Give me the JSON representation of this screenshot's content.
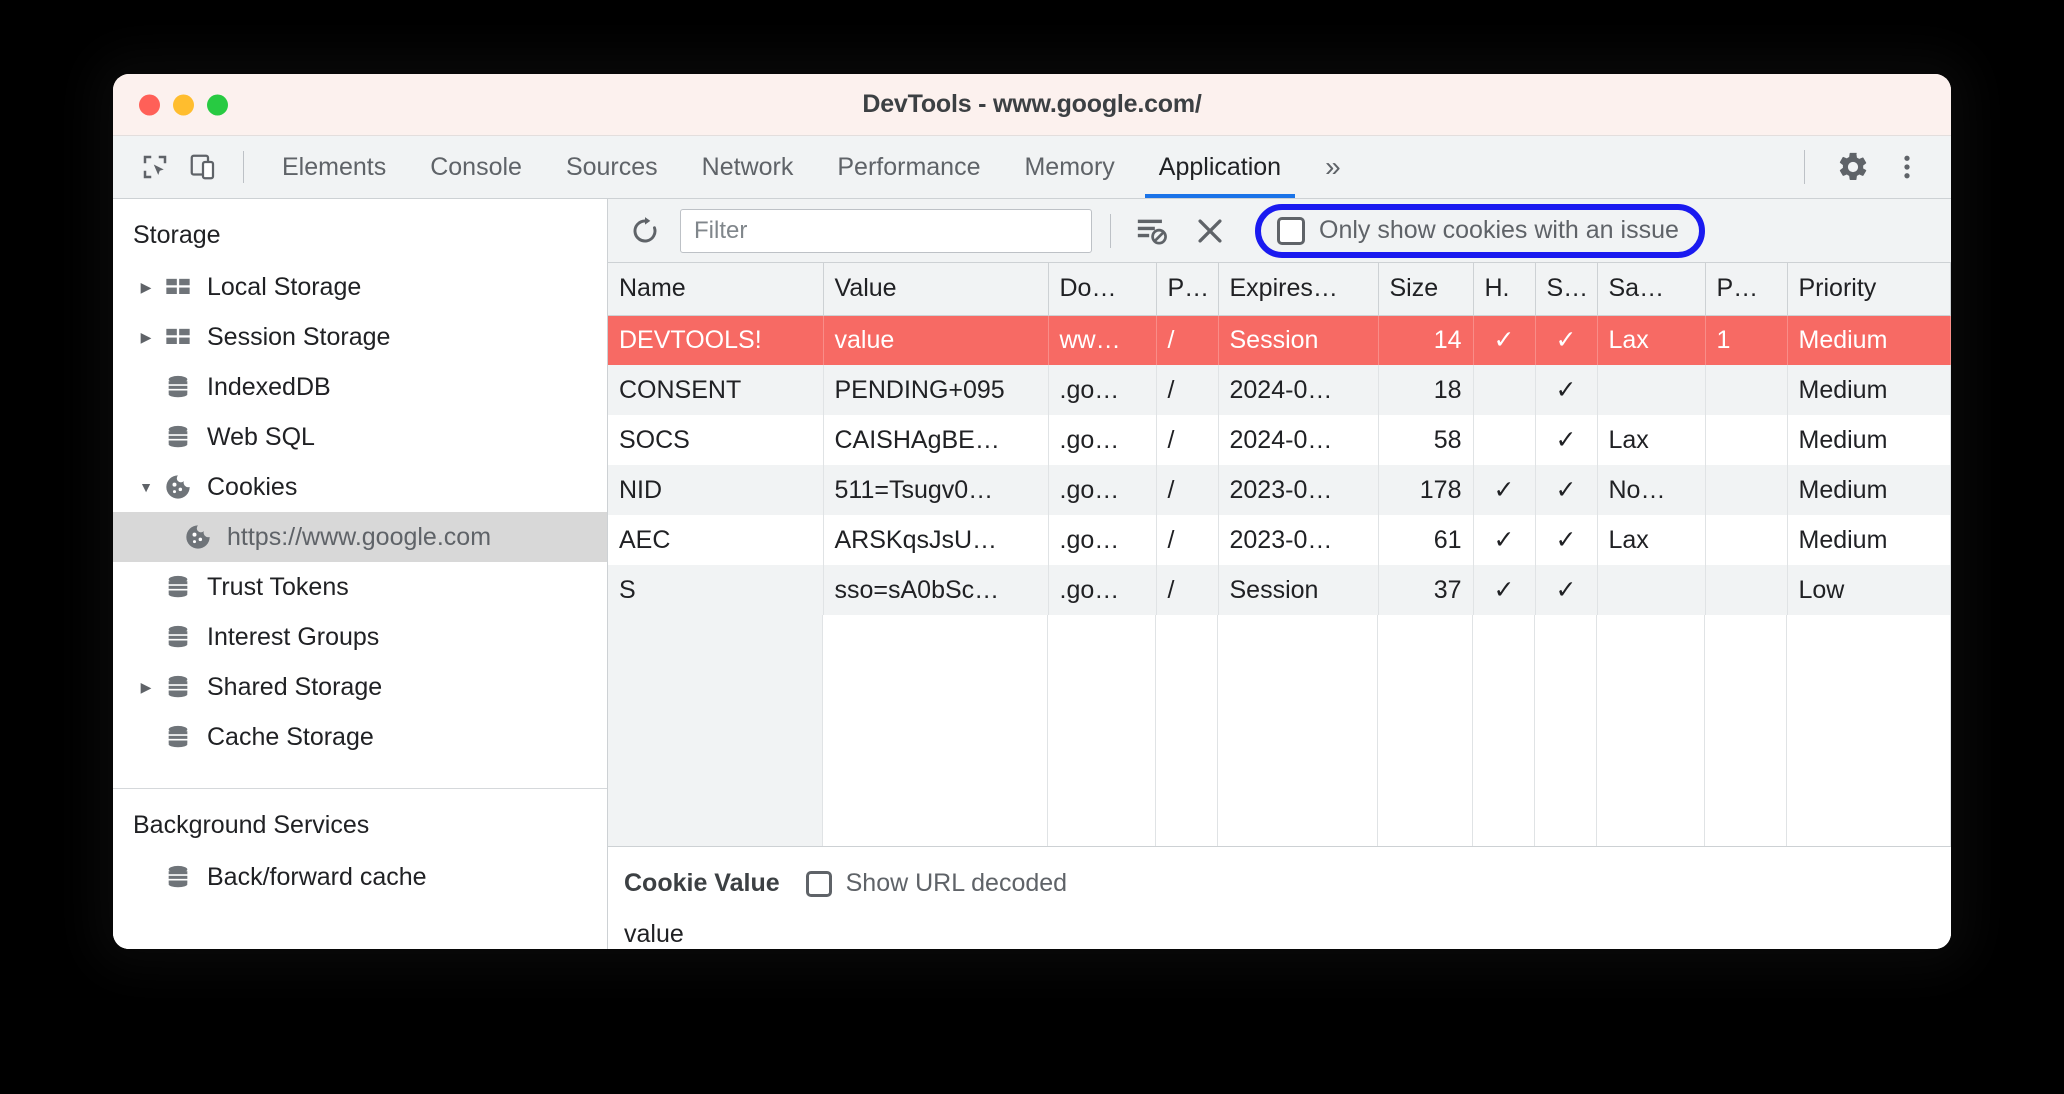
{
  "window": {
    "title": "DevTools - www.google.com/",
    "traffic_lights": [
      "close",
      "minimize",
      "zoom"
    ]
  },
  "tabbar": {
    "inspect_icon": "cursor-select-icon",
    "device_icon": "device-toolbar-icon",
    "tabs": [
      {
        "label": "Elements",
        "active": false
      },
      {
        "label": "Console",
        "active": false
      },
      {
        "label": "Sources",
        "active": false
      },
      {
        "label": "Network",
        "active": false
      },
      {
        "label": "Performance",
        "active": false
      },
      {
        "label": "Memory",
        "active": false
      },
      {
        "label": "Application",
        "active": true
      }
    ],
    "more_tabs": "»",
    "settings_icon": "gear-icon",
    "menu_icon": "kebab-menu-icon"
  },
  "sidebar": {
    "sections": [
      {
        "title": "Storage",
        "items": [
          {
            "label": "Local Storage",
            "icon": "table-icon",
            "twisty": "collapsed",
            "indent": 1,
            "selected": false
          },
          {
            "label": "Session Storage",
            "icon": "table-icon",
            "twisty": "collapsed",
            "indent": 1,
            "selected": false
          },
          {
            "label": "IndexedDB",
            "icon": "database-icon",
            "twisty": "none",
            "indent": 1,
            "selected": false
          },
          {
            "label": "Web SQL",
            "icon": "database-icon",
            "twisty": "none",
            "indent": 1,
            "selected": false
          },
          {
            "label": "Cookies",
            "icon": "cookie-icon",
            "twisty": "expanded",
            "indent": 1,
            "selected": false
          },
          {
            "label": "https://www.google.com",
            "icon": "cookie-icon",
            "twisty": "none",
            "indent": 2,
            "selected": true
          },
          {
            "label": "Trust Tokens",
            "icon": "database-icon",
            "twisty": "none",
            "indent": 1,
            "selected": false
          },
          {
            "label": "Interest Groups",
            "icon": "database-icon",
            "twisty": "none",
            "indent": 1,
            "selected": false
          },
          {
            "label": "Shared Storage",
            "icon": "database-icon",
            "twisty": "collapsed",
            "indent": 1,
            "selected": false
          },
          {
            "label": "Cache Storage",
            "icon": "database-icon",
            "twisty": "none",
            "indent": 1,
            "selected": false
          }
        ]
      },
      {
        "title": "Background Services",
        "items": [
          {
            "label": "Back/forward cache",
            "icon": "database-icon",
            "twisty": "none",
            "indent": 1,
            "selected": false
          }
        ]
      }
    ]
  },
  "filterbar": {
    "refresh_icon": "refresh-icon",
    "filter_placeholder": "Filter",
    "filter_value": "",
    "clear_filtered_icon": "clear-filtered-cookies-icon",
    "clear_all_icon": "close-x-icon",
    "issue_checkbox_label": "Only show cookies with an issue",
    "issue_checkbox_checked": false,
    "highlight_color": "#1a1af0"
  },
  "grid": {
    "columns": [
      "Name",
      "Value",
      "Do…",
      "P…",
      "Expires…",
      "Size",
      "H.",
      "S…",
      "Sa…",
      "P…",
      "Priority"
    ],
    "rows": [
      {
        "issue": true,
        "cells": [
          "DEVTOOLS!",
          "value",
          "ww…",
          "/",
          "Session",
          "14",
          "✓",
          "✓",
          "Lax",
          "1",
          "Medium"
        ]
      },
      {
        "issue": false,
        "cells": [
          "CONSENT",
          "PENDING+095",
          ".go…",
          "/",
          "2024-0…",
          "18",
          "",
          "✓",
          "",
          "",
          "Medium"
        ]
      },
      {
        "issue": false,
        "cells": [
          "SOCS",
          "CAISHAgBE…",
          ".go…",
          "/",
          "2024-0…",
          "58",
          "",
          "✓",
          "Lax",
          "",
          "Medium"
        ]
      },
      {
        "issue": false,
        "cells": [
          "NID",
          "511=Tsugv0…",
          ".go…",
          "/",
          "2023-0…",
          "178",
          "✓",
          "✓",
          "No…",
          "",
          "Medium"
        ]
      },
      {
        "issue": false,
        "cells": [
          "AEC",
          "ARSKqsJsU…",
          ".go…",
          "/",
          "2023-0…",
          "61",
          "✓",
          "✓",
          "Lax",
          "",
          "Medium"
        ]
      },
      {
        "issue": false,
        "cells": [
          "S",
          "sso=sA0bSc…",
          ".go…",
          "/",
          "Session",
          "37",
          "✓",
          "✓",
          "",
          "",
          "Low"
        ]
      }
    ]
  },
  "preview": {
    "title": "Cookie Value",
    "decode_checkbox_label": "Show URL decoded",
    "decode_checkbox_checked": false,
    "value": "value"
  }
}
